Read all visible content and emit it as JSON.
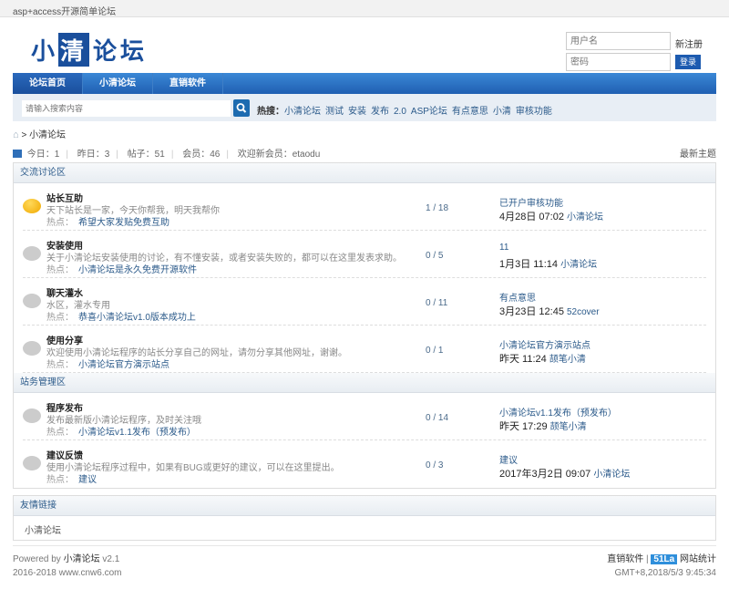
{
  "top_title": "asp+access开源简单论坛",
  "logo": {
    "part1": "小",
    "part2": "清",
    "part3": "论坛"
  },
  "login": {
    "username_placeholder": "用户名",
    "password_placeholder": "密码",
    "register": "新注册",
    "submit": "登录"
  },
  "nav": [
    "论坛首页",
    "小清论坛",
    "直销软件"
  ],
  "search": {
    "placeholder": "请输入搜索内容",
    "hot_label": "热搜：",
    "hot": [
      "小清论坛",
      "测试",
      "安装",
      "发布",
      "2.0",
      "ASP论坛",
      "有点意思",
      "小清",
      "审核功能"
    ]
  },
  "breadcrumb": {
    "sep": ">",
    "current": "小清论坛"
  },
  "stats": {
    "today": "今日：1",
    "yesterday": "昨日：3",
    "posts": "帖子：51",
    "members": "会员：46",
    "newest": "欢迎新会员：etaodu",
    "latest_link": "最新主题"
  },
  "sections": [
    {
      "title": "交流讨论区",
      "forums": [
        {
          "title": "站长互助",
          "desc": "天下站长是一家，今天你帮我，明天我帮你",
          "hot_label": "热点：",
          "hot": "希望大家发贴免费互助",
          "count": "1 / 18",
          "last_title": "已开户审核功能",
          "last_time": "4月28日 07:02",
          "last_user": "小清论坛",
          "new": true
        },
        {
          "title": "安装使用",
          "desc": "关于小清论坛安装使用的讨论，有不懂安装，或者安装失败的，都可以在这里发表求助。",
          "hot_label": "热点：",
          "hot": "小清论坛是永久免费开源软件",
          "count": "0 / 5",
          "last_title": "11",
          "last_time": "1月3日 11:14",
          "last_user": "小清论坛",
          "new": false
        },
        {
          "title": "聊天灌水",
          "desc": "水区，灌水专用",
          "hot_label": "热点：",
          "hot": "恭喜小清论坛v1.0版本成功上",
          "count": "0 / 11",
          "last_title": "有点意思",
          "last_time": "3月23日 12:45",
          "last_user": "52cover",
          "new": false
        },
        {
          "title": "使用分享",
          "desc": "欢迎使用小清论坛程序的站长分享自己的网址，请勿分享其他网址，谢谢。",
          "hot_label": "热点：",
          "hot": "小清论坛官方演示站点",
          "count": "0 / 1",
          "last_title": "小清论坛官方演示站点",
          "last_time": "昨天 11:24",
          "last_user": "颉笔小清",
          "new": false
        }
      ]
    },
    {
      "title": "站务管理区",
      "forums": [
        {
          "title": "程序发布",
          "desc": "发布最新版小清论坛程序，及时关注哦",
          "hot_label": "热点：",
          "hot": "小清论坛v1.1发布（预发布）",
          "count": "0 / 14",
          "last_title": "小清论坛v1.1发布（预发布）",
          "last_time": "昨天 17:29",
          "last_user": "颉笔小清",
          "new": false
        },
        {
          "title": "建议反馈",
          "desc": "使用小清论坛程序过程中，如果有BUG或更好的建议，可以在这里提出。",
          "hot_label": "热点：",
          "hot": "建议",
          "count": "0 / 3",
          "last_title": "建议",
          "last_time": "2017年3月2日 09:07",
          "last_user": "小清论坛",
          "new": false
        }
      ]
    }
  ],
  "links": {
    "title": "友情链接",
    "items": [
      "小清论坛"
    ]
  },
  "footer": {
    "powered": "Powered by",
    "product": "小清论坛",
    "version": "v2.1",
    "copyright": "2016-2018 www.cnw6.com",
    "right_link": "直销软件",
    "right_sep": "|",
    "stat_badge": "51La",
    "stat_label": "网站统计",
    "time": "GMT+8,2018/5/3 9:45:34"
  },
  "colors": {
    "brand": "#1a4f9c",
    "nav": "#1f5fb2",
    "link": "#2b5a8a",
    "new_icon": "#f0a800"
  }
}
